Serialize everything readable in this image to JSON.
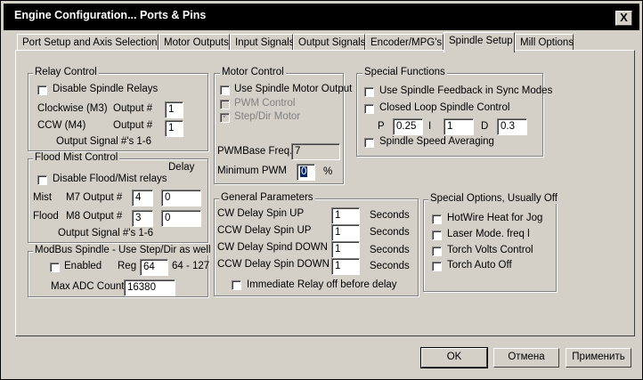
{
  "window": {
    "title": "Engine Configuration... Ports & Pins",
    "close": "X"
  },
  "tabs": [
    "Port Setup and Axis Selection",
    "Motor Outputs",
    "Input Signals",
    "Output Signals",
    "Encoder/MPG's",
    "Spindle Setup",
    "Mill Options"
  ],
  "relay": {
    "title": "Relay Control",
    "disable": "Disable Spindle Relays",
    "cw_label": "Clockwise (M3)",
    "ccw_label": "CCW (M4)",
    "output": "Output #",
    "cw_value": "1",
    "ccw_value": "1",
    "note": "Output Signal #'s 1-6"
  },
  "flood": {
    "title": "Flood Mist Control",
    "disable": "Disable Flood/Mist relays",
    "delay": "Delay",
    "mist": "Mist",
    "mist_out": "M7 Output #",
    "mist_value": "4",
    "mist_delay": "0",
    "flood": "Flood",
    "flood_out": "M8 Output #",
    "flood_value": "3",
    "flood_delay": "0",
    "note": "Output Signal #'s 1-6"
  },
  "modbus": {
    "title": "ModBus Spindle - Use Step/Dir as well",
    "enabled": "Enabled",
    "reg": "Reg",
    "reg_value": "64",
    "range": "64 - 127",
    "adc": "Max ADC Count",
    "adc_value": "16380"
  },
  "motor": {
    "title": "Motor Control",
    "use_motor": "Use Spindle Motor Output",
    "pwm": "PWM Control",
    "stepdir": "Step/Dir Motor",
    "pwmbase": "PWMBase Freq.",
    "pwmbase_value": "7",
    "minpwm": "Minimum PWM",
    "minpwm_value": "0",
    "pct": "%"
  },
  "general": {
    "title": "General Parameters",
    "seconds": "Seconds",
    "rows": [
      {
        "label": "CW Delay Spin UP",
        "value": "1"
      },
      {
        "label": "CCW Delay Spin UP",
        "value": "1"
      },
      {
        "label": "CW Delay Spind DOWN",
        "value": "1"
      },
      {
        "label": "CCW Delay Spin DOWN",
        "value": "1"
      }
    ],
    "immediate": "Immediate Relay off before delay"
  },
  "special": {
    "title": "Special Functions",
    "feedback": "Use Spindle Feedback in Sync Modes",
    "closed": "Closed Loop Spindle Control",
    "p": "P",
    "p_value": "0.25",
    "i": "I",
    "i_value": "1",
    "d": "D",
    "d_value": "0.3",
    "avg": "Spindle Speed Averaging"
  },
  "options": {
    "title": "Special Options, Usually Off",
    "items": [
      "HotWire Heat for Jog",
      "Laser Mode. freq l",
      "Torch Volts Control",
      "Torch Auto Off"
    ]
  },
  "buttons": {
    "ok": "OK",
    "cancel": "Отмена",
    "apply": "Применить"
  }
}
